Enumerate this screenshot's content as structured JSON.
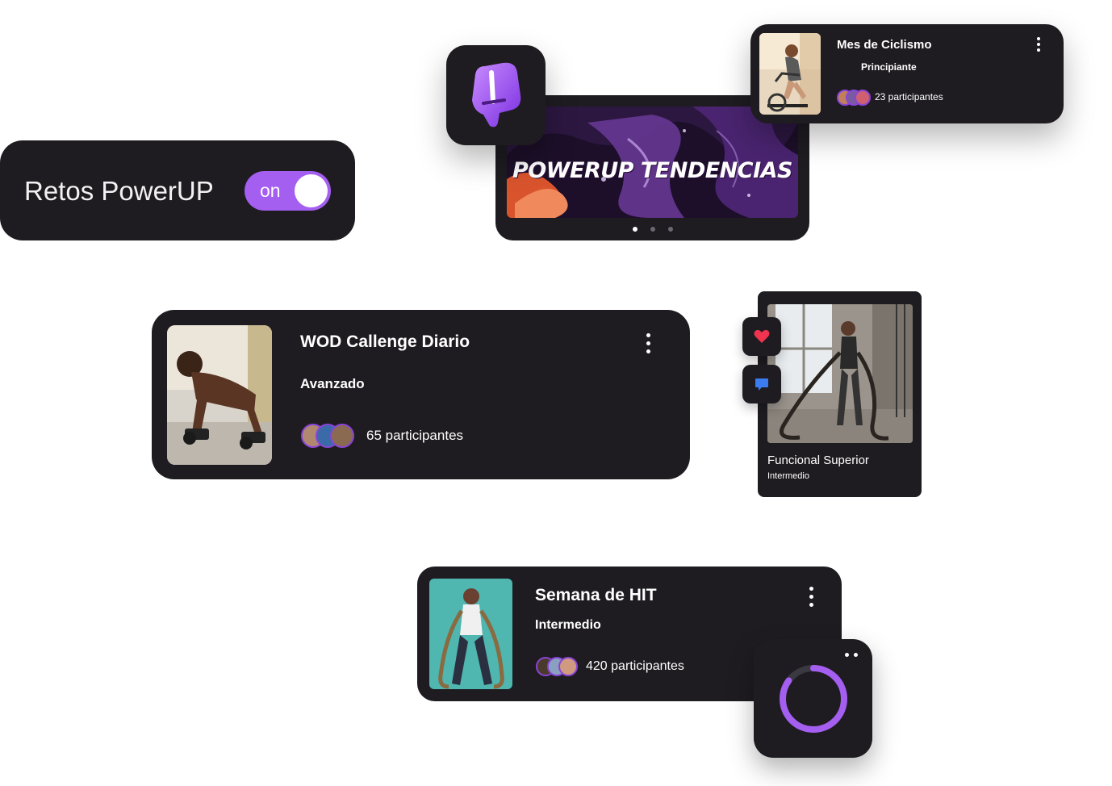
{
  "toggle": {
    "title": "Retos PowerUP",
    "state_label": "on"
  },
  "banner": {
    "title": "POWERUP TENDENCIAS",
    "slides": 3,
    "active_slide": 1
  },
  "challenges": [
    {
      "name": "Mes de Ciclismo",
      "level": "Principiante",
      "participants": "23 participantes"
    },
    {
      "name": "WOD Callenge Diario",
      "level": "Avanzado",
      "participants": "65 participantes"
    },
    {
      "name": "Funcional Superior",
      "level": "Intermedio"
    },
    {
      "name": "Semana de HIT",
      "level": "Intermedio",
      "participants": "420 participantes"
    }
  ],
  "progress": {
    "value": 0.85
  },
  "colors": {
    "accent": "#a45ef0",
    "card": "#1e1c21",
    "heart": "#f0334e",
    "chat": "#3b7cf0"
  }
}
